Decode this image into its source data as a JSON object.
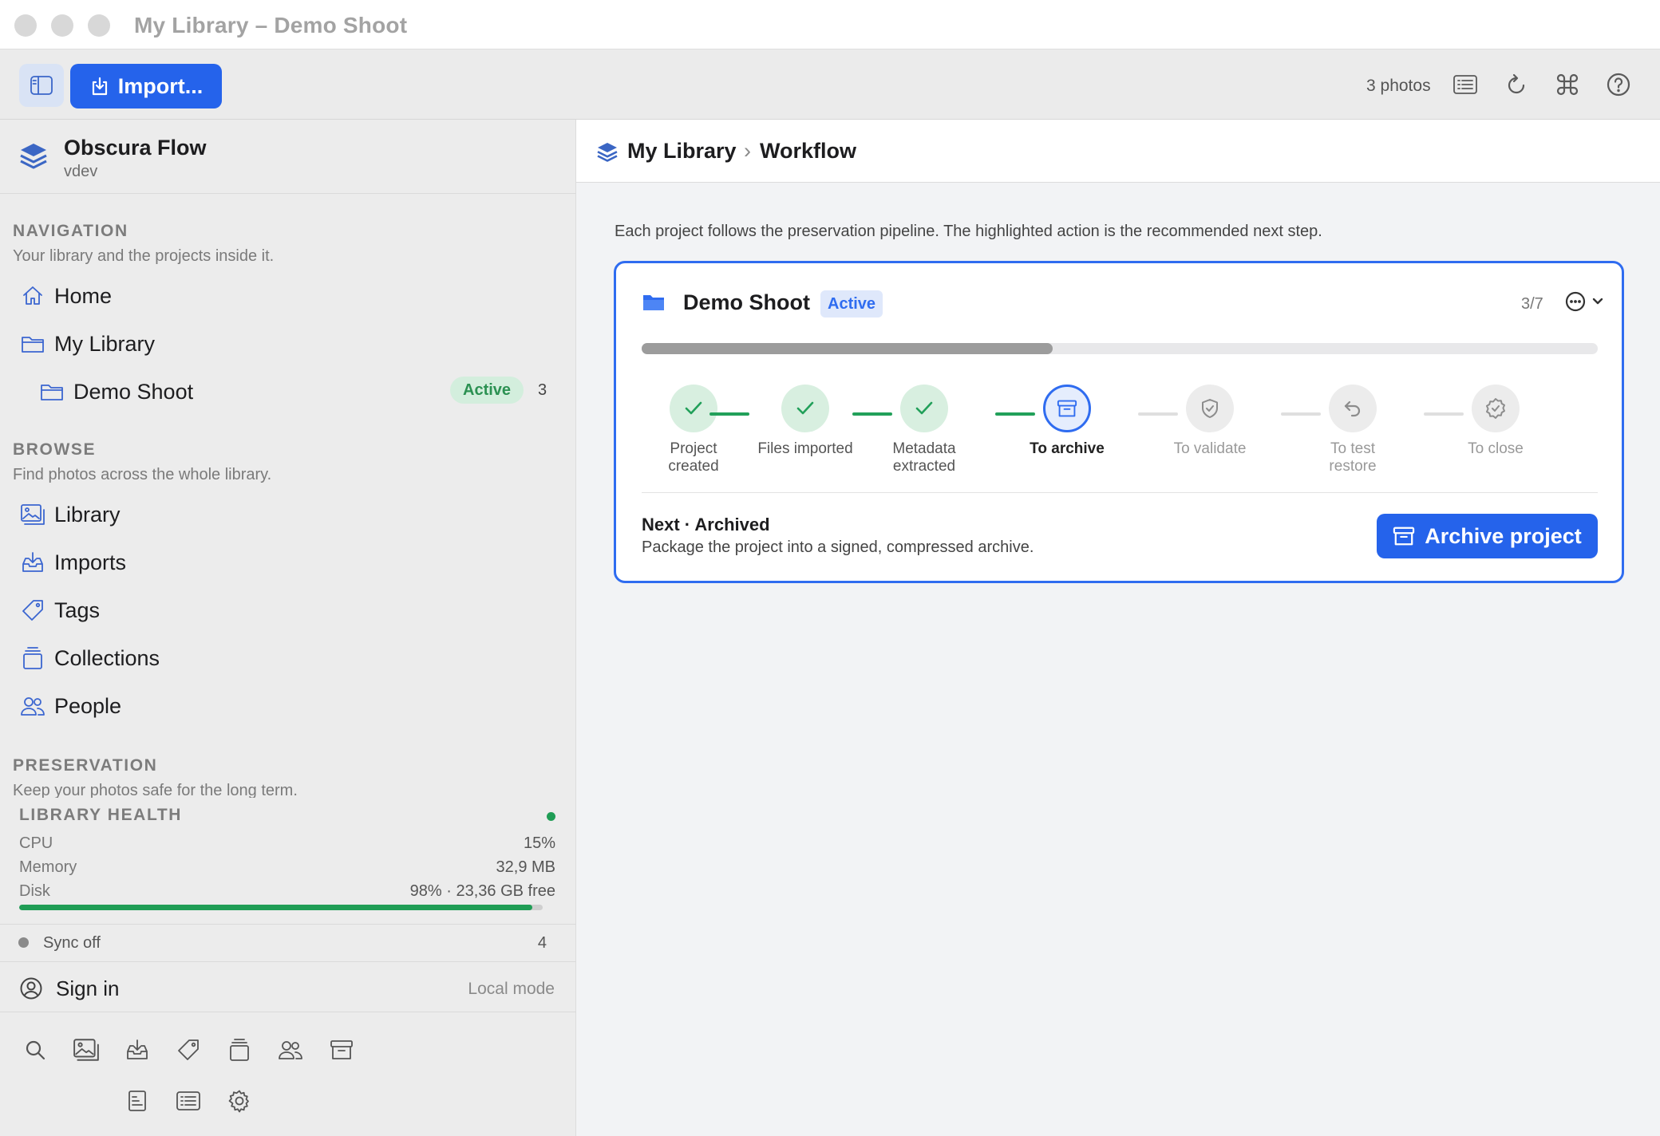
{
  "window": {
    "title": "My Library – Demo Shoot"
  },
  "toolbar": {
    "import_label": "Import...",
    "photo_count": "3 photos"
  },
  "brand": {
    "name": "Obscura Flow",
    "version": "vdev"
  },
  "sidebar": {
    "navigation": {
      "title": "NAVIGATION",
      "subtitle": "Your library and the projects inside it.",
      "items": [
        {
          "label": "Home",
          "icon": "home-icon"
        },
        {
          "label": "My Library",
          "icon": "folder-icon"
        },
        {
          "label": "Demo Shoot",
          "icon": "folder-icon",
          "badge": "Active",
          "count": "3"
        }
      ]
    },
    "browse": {
      "title": "BROWSE",
      "subtitle": "Find photos across the whole library.",
      "items": [
        {
          "label": "Library",
          "icon": "photos-icon"
        },
        {
          "label": "Imports",
          "icon": "tray-download-icon"
        },
        {
          "label": "Tags",
          "icon": "tag-icon"
        },
        {
          "label": "Collections",
          "icon": "stack-icon"
        },
        {
          "label": "People",
          "icon": "people-icon"
        }
      ]
    },
    "preservation": {
      "title": "PRESERVATION",
      "subtitle": "Keep your photos safe for the long term."
    },
    "health": {
      "title": "LIBRARY HEALTH",
      "cpu_label": "CPU",
      "cpu_value": "15%",
      "memory_label": "Memory",
      "memory_value": "32,9 MB",
      "disk_label": "Disk",
      "disk_value": "98% · 23,36 GB free",
      "disk_fraction": 0.98,
      "status_color": "#1f9d55"
    },
    "sync": {
      "label": "Sync off",
      "count": "4"
    },
    "account": {
      "label": "Sign in",
      "mode": "Local mode"
    }
  },
  "breadcrumb": {
    "root": "My Library",
    "separator": "›",
    "current": "Workflow"
  },
  "main": {
    "intro": "Each project follows the preservation pipeline. The highlighted action is the recommended next step.",
    "project": {
      "name": "Demo Shoot",
      "status": "Active",
      "step_counter": "3/7",
      "progress_fraction": 0.43,
      "steps": [
        {
          "label": "Project created",
          "state": "done"
        },
        {
          "label": "Files imported",
          "state": "done"
        },
        {
          "label": "Metadata extracted",
          "state": "done"
        },
        {
          "label": "To archive",
          "state": "current"
        },
        {
          "label": "To validate",
          "state": "todo"
        },
        {
          "label": "To test restore",
          "state": "todo"
        },
        {
          "label": "To close",
          "state": "todo"
        }
      ],
      "next_title": "Next · Archived",
      "next_description": "Package the project into a signed, compressed archive.",
      "action_label": "Archive project"
    }
  },
  "colors": {
    "accent": "#2563eb",
    "success": "#22a05a",
    "muted": "#9c9c9c"
  }
}
